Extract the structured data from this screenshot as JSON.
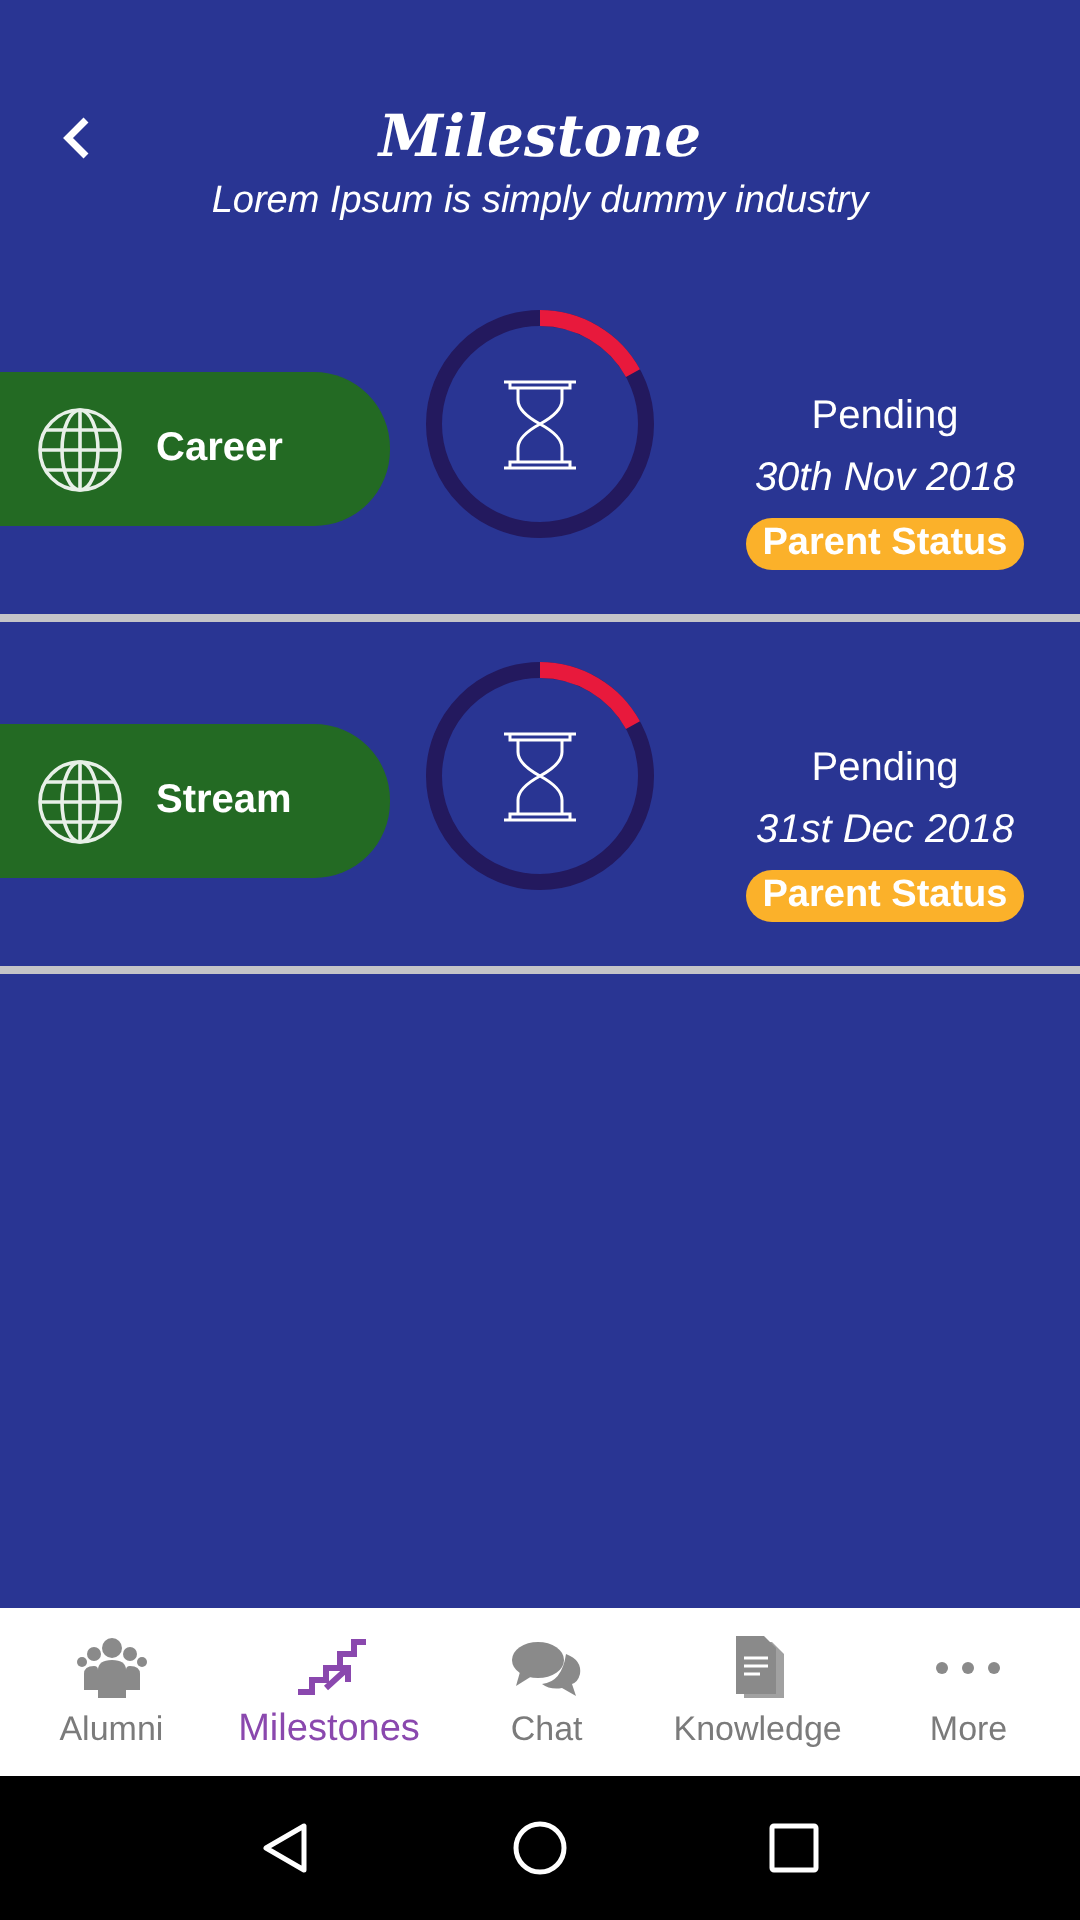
{
  "header": {
    "title": "Milestone",
    "subtitle": "Lorem Ipsum is simply dummy industry"
  },
  "milestones": [
    {
      "name": "Career",
      "level": 0.17,
      "status": "Pending",
      "date": "30th Nov 2018",
      "badge": "Parent Status"
    },
    {
      "name": "Stream",
      "level": 0.17,
      "status": "Pending",
      "date": "31st Dec 2018",
      "badge": "Parent Status"
    }
  ],
  "nav": [
    {
      "kind": "people",
      "label": "Alumni",
      "selected": false
    },
    {
      "kind": "stairs",
      "label": "Milestones",
      "selected": true
    },
    {
      "kind": "chat",
      "label": "Chat",
      "selected": false
    },
    {
      "kind": "document",
      "label": "Knowledge",
      "selected": false
    },
    {
      "kind": "dots",
      "label": "More",
      "selected": false
    }
  ]
}
